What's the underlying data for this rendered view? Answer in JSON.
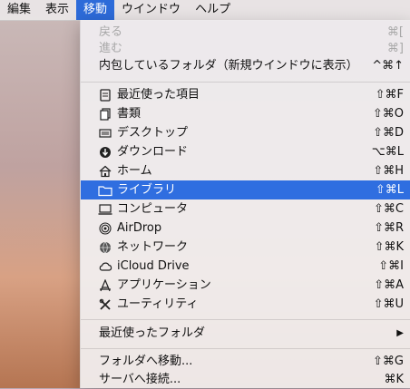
{
  "menubar": {
    "items": [
      {
        "label": "編集"
      },
      {
        "label": "表示"
      },
      {
        "label": "移動",
        "active": true
      },
      {
        "label": "ウインドウ"
      },
      {
        "label": "ヘルプ"
      }
    ]
  },
  "go_menu": {
    "items": [
      {
        "label": "戻る",
        "shortcut": "⌘[",
        "enabled": false
      },
      {
        "label": "進む",
        "shortcut": "⌘]",
        "enabled": false
      },
      {
        "label": "内包しているフォルダ（新規ウインドウに表示）",
        "shortcut": "^⌘↑",
        "enabled": true
      },
      {
        "label": "最近使った項目",
        "shortcut": "⇧⌘F",
        "icon": "recents-icon"
      },
      {
        "label": "書類",
        "shortcut": "⇧⌘O",
        "icon": "documents-icon"
      },
      {
        "label": "デスクトップ",
        "shortcut": "⇧⌘D",
        "icon": "desktop-icon"
      },
      {
        "label": "ダウンロード",
        "shortcut": "⌥⌘L",
        "icon": "downloads-icon"
      },
      {
        "label": "ホーム",
        "shortcut": "⇧⌘H",
        "icon": "home-icon"
      },
      {
        "label": "ライブラリ",
        "shortcut": "⇧⌘L",
        "icon": "folder-icon",
        "selected": true
      },
      {
        "label": "コンピュータ",
        "shortcut": "⇧⌘C",
        "icon": "computer-icon"
      },
      {
        "label": "AirDrop",
        "shortcut": "⇧⌘R",
        "icon": "airdrop-icon"
      },
      {
        "label": "ネットワーク",
        "shortcut": "⇧⌘K",
        "icon": "network-icon"
      },
      {
        "label": "iCloud Drive",
        "shortcut": "⇧⌘I",
        "icon": "cloud-icon"
      },
      {
        "label": "アプリケーション",
        "shortcut": "⇧⌘A",
        "icon": "applications-icon"
      },
      {
        "label": "ユーティリティ",
        "shortcut": "⇧⌘U",
        "icon": "utilities-icon"
      },
      {
        "label": "最近使ったフォルダ",
        "submenu_arrow": "▶"
      },
      {
        "label": "フォルダへ移動...",
        "shortcut": "⇧⌘G"
      },
      {
        "label": "サーバへ接続...",
        "shortcut": "⌘K"
      }
    ]
  },
  "colors": {
    "menu_highlight": "#2f6ee0",
    "disabled_text": "#a8a8a8"
  }
}
